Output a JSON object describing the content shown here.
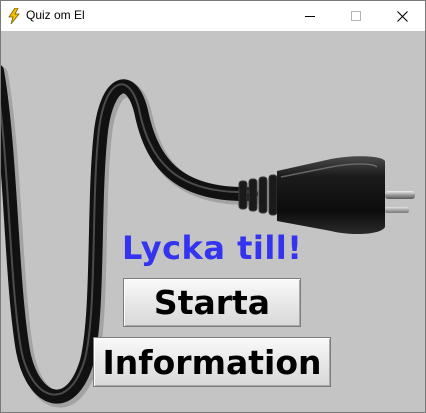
{
  "window": {
    "title": "Quiz om El",
    "app_icon": "lightning-bolt-icon",
    "controls": {
      "minimize_icon": "minimize-icon",
      "maximize_icon": "maximize-icon",
      "close_icon": "close-icon"
    }
  },
  "main": {
    "greeting": "Lycka till!",
    "start_label": "Starta",
    "info_label": "Information",
    "background_image": "power-cable-plug"
  },
  "colors": {
    "greeting": "#3434f0",
    "background": "#c4c4c4",
    "cable": "#111111"
  }
}
